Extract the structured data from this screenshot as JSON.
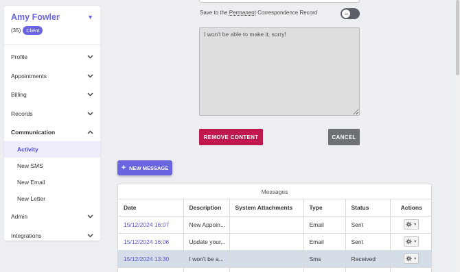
{
  "client": {
    "name": "Amy Fowler",
    "age": "(35)",
    "badge": "Client"
  },
  "sidebar": {
    "items": [
      {
        "label": "Profile"
      },
      {
        "label": "Appointments"
      },
      {
        "label": "Billing"
      },
      {
        "label": "Records"
      },
      {
        "label": "Communication"
      },
      {
        "label": "Admin"
      },
      {
        "label": "Integrations"
      }
    ],
    "communication_sub": [
      {
        "label": "Activity"
      },
      {
        "label": "New SMS"
      },
      {
        "label": "New Email"
      },
      {
        "label": "New Letter"
      }
    ]
  },
  "form": {
    "save_label_prefix": "Save to the ",
    "save_label_link": "Permanent",
    "save_label_suffix": " Correspondence Record",
    "toggle_on": false,
    "message_text": "I won't be able to make it, sorry!",
    "remove_label": "REMOVE CONTENT",
    "cancel_label": "CANCEL"
  },
  "new_message_label": "NEW MESSAGE",
  "messages": {
    "title": "Messages",
    "columns": [
      "Date",
      "Description",
      "System Attachments",
      "Type",
      "Status",
      "Actions"
    ],
    "rows": [
      {
        "date": "15/12/2024 16:07",
        "description": "New Appoin...",
        "attachments": "",
        "type": "Email",
        "status": "Sent"
      },
      {
        "date": "15/12/2024 16:06",
        "description": "Update your...",
        "attachments": "",
        "type": "Email",
        "status": "Sent"
      },
      {
        "date": "15/12/2024 13:30",
        "description": "I won't be a...",
        "attachments": "",
        "type": "Sms",
        "status": "Received"
      }
    ]
  },
  "icons": {
    "chevron": "chevron-down-icon",
    "gear": "gear-icon"
  },
  "colors": {
    "accent": "#6a64e0",
    "danger": "#c0174f",
    "neutral_button": "#6e7175",
    "selected_row": "#d5dde9"
  }
}
